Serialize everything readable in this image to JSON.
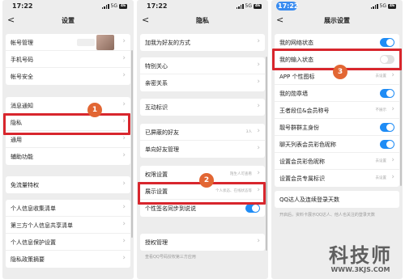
{
  "panel1": {
    "time": "17:22",
    "network": "5G",
    "battery": "46",
    "back_glyph": "<",
    "title": "设置",
    "groups": [
      [
        {
          "label": "帐号管理"
        },
        {
          "label": "手机号码"
        },
        {
          "label": "帐号安全"
        }
      ],
      [
        {
          "label": "消息通知"
        },
        {
          "label": "隐私"
        },
        {
          "label": "通用"
        },
        {
          "label": "辅助功能"
        }
      ],
      [
        {
          "label": "免流量特权"
        }
      ],
      [
        {
          "label": "个人信息收集清单"
        },
        {
          "label": "第三方个人信息共享清单"
        },
        {
          "label": "个人信息保护设置"
        },
        {
          "label": "隐私政策摘要"
        }
      ]
    ]
  },
  "panel2": {
    "time": "17:22",
    "network": "5G",
    "battery": "46",
    "back_glyph": "<",
    "title": "隐私",
    "groups": [
      [
        {
          "label": "加我为好友的方式"
        }
      ],
      [
        {
          "label": "特别关心"
        },
        {
          "label": "亲密关系"
        }
      ],
      [
        {
          "label": "互动标识"
        }
      ],
      [
        {
          "label": "已屏蔽的好友",
          "value": "3人"
        },
        {
          "label": "单向好友管理"
        }
      ],
      [
        {
          "label": "权限设置",
          "value": "陌生人可查看"
        },
        {
          "label": "展示设置",
          "value": "个人状态、在线状态等"
        },
        {
          "label": "个性签名同步到说说"
        }
      ],
      [
        {
          "label": "授权管理"
        }
      ]
    ],
    "caption": "查看QQ号码授权第三方应用"
  },
  "panel3": {
    "time": "17:22",
    "network": "5G",
    "battery": "46",
    "back_glyph": "<",
    "title": "展示设置",
    "group1": [
      {
        "label": "我的网络状态"
      },
      {
        "label": "我的输入状态"
      },
      {
        "label": "APP 个性图标",
        "value": "去设置"
      },
      {
        "label": "我的勋章墙"
      },
      {
        "label": "王者段位&会员称号",
        "value": "不展示"
      },
      {
        "label": "靓号群群主身份"
      },
      {
        "label": "聊天列表会员彩色昵称"
      },
      {
        "label": "设置会员彩色昵称",
        "value": "去设置"
      },
      {
        "label": "设置会员专属标识",
        "value": "去设置"
      }
    ],
    "group2": [
      {
        "label": "QQ达人及连续登录天数"
      }
    ],
    "caption": "开启后，资料卡展示QQ达人、他人也关注的登录天数"
  },
  "steps": [
    "1",
    "2",
    "3"
  ],
  "watermark": {
    "big": "科技师",
    "small": "WWW.3KJS.COM"
  },
  "colors": {
    "highlight": "#d8262d",
    "step_badge": "#e26633",
    "toggle_on": "#1f8cf5"
  }
}
